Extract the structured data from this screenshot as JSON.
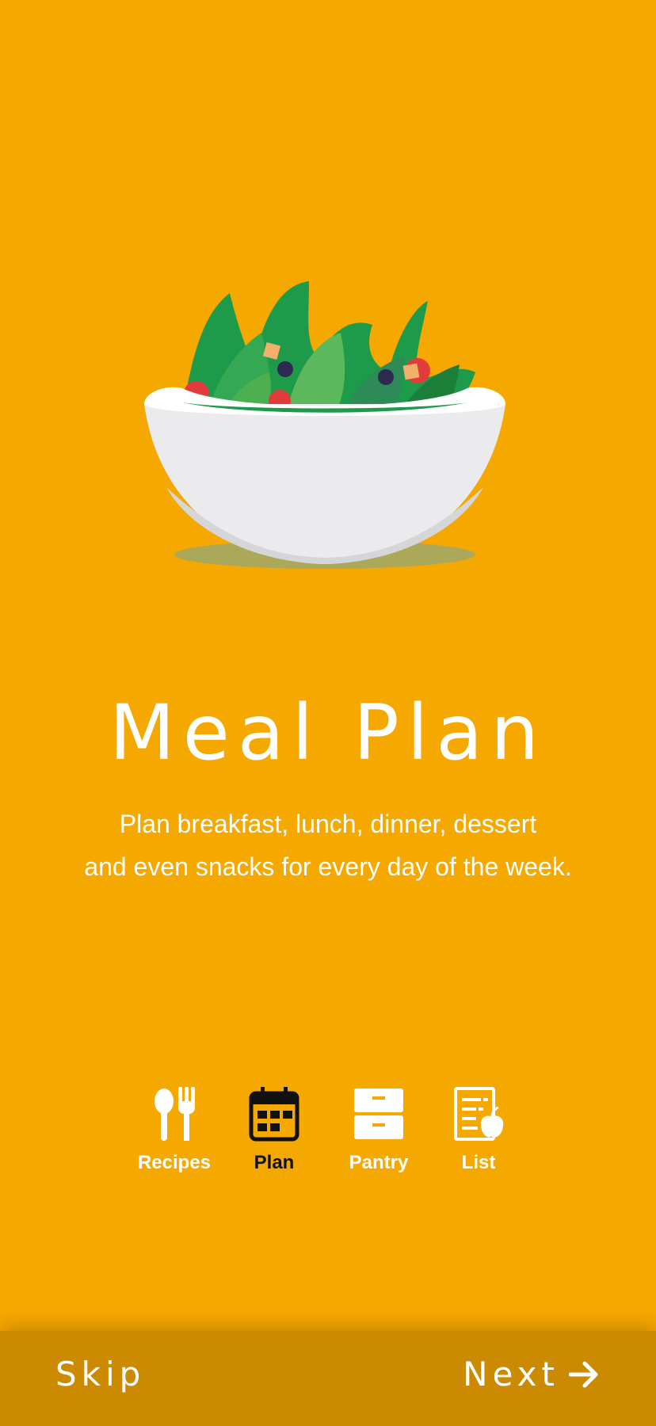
{
  "onboarding": {
    "title": "Meal Plan",
    "description_line1": "Plan breakfast, lunch, dinner, dessert",
    "description_line2": "and even snacks for every day of the week.",
    "illustration": "salad-bowl-illustration"
  },
  "features": [
    {
      "label": "Recipes",
      "icon": "spoon-fork-icon",
      "active": false
    },
    {
      "label": "Plan",
      "icon": "calendar-icon",
      "active": true
    },
    {
      "label": "Pantry",
      "icon": "cabinet-icon",
      "active": false
    },
    {
      "label": "List",
      "icon": "list-apple-icon",
      "active": false
    }
  ],
  "navigation": {
    "skip_label": "Skip",
    "next_label": "Next",
    "next_icon": "arrow-right-icon"
  },
  "colors": {
    "background": "#F5A800",
    "bottom_bar": "#CC8A00",
    "text": "#FFFFFF",
    "active_feature": "#111111"
  }
}
